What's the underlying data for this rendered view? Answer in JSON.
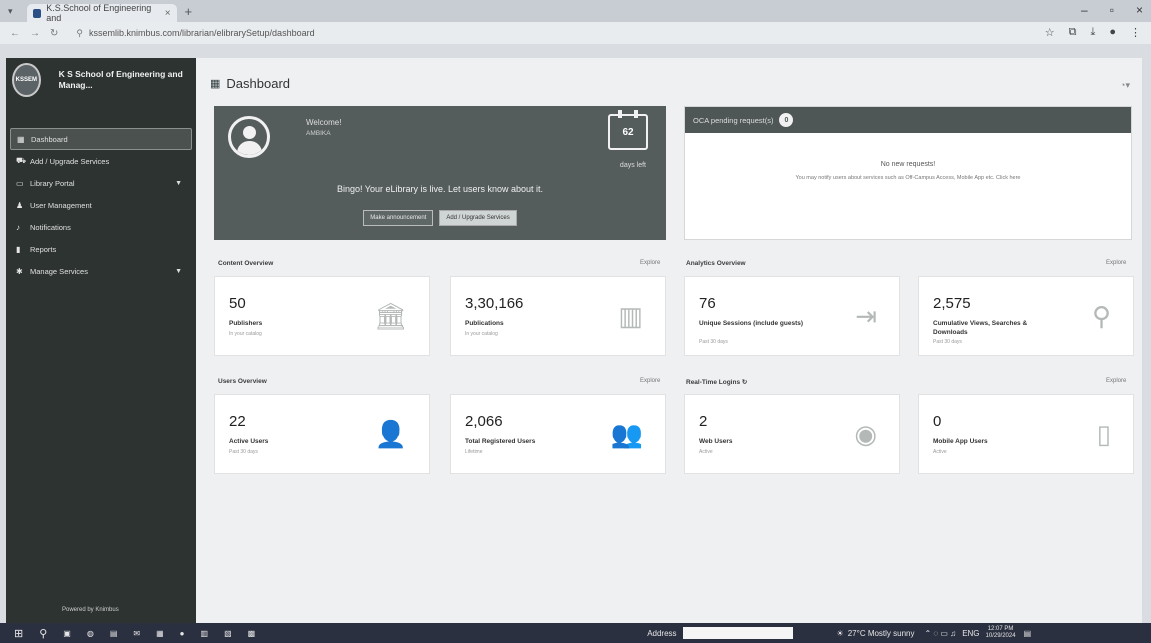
{
  "browser": {
    "tab_title": "K.S.School of Engineering and",
    "url": "kssemlib.knimbus.com/librarian/elibrarySetup/dashboard"
  },
  "sidebar": {
    "brand_name": "K S School of Engineering and Manag...",
    "logo_text": "KSSEM",
    "items": [
      {
        "label": "Dashboard",
        "icon": "grid-icon"
      },
      {
        "label": "Add / Upgrade Services",
        "icon": "cart-icon"
      },
      {
        "label": "Library Portal",
        "icon": "monitor-icon"
      },
      {
        "label": "User Management",
        "icon": "user-icon"
      },
      {
        "label": "Notifications",
        "icon": "bell-icon"
      },
      {
        "label": "Reports",
        "icon": "bar-chart-icon"
      },
      {
        "label": "Manage Services",
        "icon": "cog-icon"
      }
    ],
    "powered_by": "Powered by Knimbus"
  },
  "main": {
    "page_title": "Dashboard",
    "welcome": {
      "title": "Welcome!",
      "name": "AMBIKA",
      "days": "62",
      "days_label": "days left",
      "message": "Bingo! Your eLibrary is live. Let users know about it.",
      "btn_announce": "Make announcement",
      "btn_services": "Add / Upgrade Services"
    },
    "oca": {
      "title": "OCA pending request(s)",
      "count": "0",
      "empty": "No new requests!",
      "hint": "You may notify users about services such as Off-Campus Access, Mobile App etc. Click here"
    },
    "content_overview": {
      "label": "Content Overview",
      "link": "Explore",
      "cards": [
        {
          "num": "50",
          "label": "Publishers",
          "sub": "In your catalog"
        },
        {
          "num": "3,30,166",
          "label": "Publications",
          "sub": "In your catalog"
        }
      ]
    },
    "analytics_overview": {
      "label": "Analytics Overview",
      "link": "Explore",
      "cards": [
        {
          "num": "76",
          "label": "Unique Sessions (include guests)",
          "sub": "Past 30 days"
        },
        {
          "num": "2,575",
          "label": "Cumulative Views, Searches & Downloads",
          "sub": "Past 30 days"
        }
      ]
    },
    "users_overview": {
      "label": "Users Overview",
      "link": "Explore",
      "cards": [
        {
          "num": "22",
          "label": "Active Users",
          "sub": "Past 30 days"
        },
        {
          "num": "2,066",
          "label": "Total Registered Users",
          "sub": "Lifetime"
        }
      ]
    },
    "realtime": {
      "label": "Real-Time Logins",
      "link": "Explore",
      "cards": [
        {
          "num": "2",
          "label": "Web Users",
          "sub": "Active"
        },
        {
          "num": "0",
          "label": "Mobile App Users",
          "sub": "Active"
        }
      ]
    }
  },
  "taskbar": {
    "address_label": "Address",
    "weather": "27°C Mostly sunny",
    "lang": "ENG",
    "time": "12:07 PM",
    "date": "10/29/2024"
  }
}
